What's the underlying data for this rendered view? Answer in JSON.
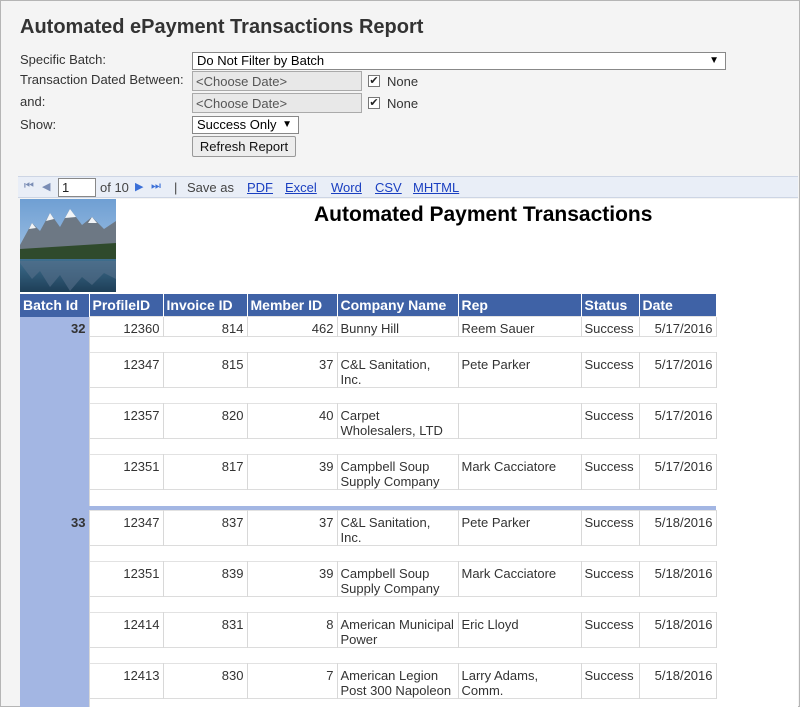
{
  "page": {
    "title": "Automated ePayment Transactions Report"
  },
  "filters": {
    "batch_label": "Specific Batch:",
    "batch_value": "Do Not Filter by Batch",
    "date_between_label": "Transaction Dated Between:",
    "date_from_placeholder": "<Choose Date>",
    "and_label": "and:",
    "date_to_placeholder": "<Choose Date>",
    "none_label_1": "None",
    "none_label_2": "None",
    "none_checked_1": true,
    "none_checked_2": true,
    "show_label": "Show:",
    "show_value": "Success Only",
    "refresh_label": "Refresh Report"
  },
  "toolbar": {
    "page_value": "1",
    "of_text": "of 10",
    "separator": "|",
    "save_as_label": "Save as",
    "formats": [
      "PDF",
      "Excel",
      "Word",
      "CSV",
      "MHTML"
    ]
  },
  "report": {
    "title": "Automated Payment Transactions",
    "columns": [
      "Batch Id",
      "ProfileID",
      "Invoice ID",
      "Member ID",
      "Company Name",
      "Rep",
      "Status",
      "Date"
    ],
    "batches": [
      {
        "batch_id": "32",
        "rows": [
          {
            "profile": "12360",
            "invoice": "814",
            "member": "462",
            "company": "Bunny Hill",
            "rep": "Reem Sauer",
            "status": "Success",
            "date": "5/17/2016"
          },
          {
            "profile": "12347",
            "invoice": "815",
            "member": "37",
            "company": "C&L Sanitation, Inc.",
            "rep": "Pete Parker",
            "status": "Success",
            "date": "5/17/2016"
          },
          {
            "profile": "12357",
            "invoice": "820",
            "member": "40",
            "company": "Carpet Wholesalers, LTD",
            "rep": "",
            "status": "Success",
            "date": "5/17/2016"
          },
          {
            "profile": "12351",
            "invoice": "817",
            "member": "39",
            "company": "Campbell Soup Supply Company",
            "rep": "Mark Cacciatore",
            "status": "Success",
            "date": "5/17/2016"
          }
        ]
      },
      {
        "batch_id": "33",
        "rows": [
          {
            "profile": "12347",
            "invoice": "837",
            "member": "37",
            "company": "C&L Sanitation, Inc.",
            "rep": "Pete Parker",
            "status": "Success",
            "date": "5/18/2016"
          },
          {
            "profile": "12351",
            "invoice": "839",
            "member": "39",
            "company": "Campbell Soup Supply Company",
            "rep": "Mark Cacciatore",
            "status": "Success",
            "date": "5/18/2016"
          },
          {
            "profile": "12414",
            "invoice": "831",
            "member": "8",
            "company": "American Municipal Power",
            "rep": "Eric Lloyd",
            "status": "Success",
            "date": "5/18/2016"
          },
          {
            "profile": "12413",
            "invoice": "830",
            "member": "7",
            "company": "American Legion Post 300 Napoleon",
            "rep": "Larry Adams, Comm.",
            "status": "Success",
            "date": "5/18/2016"
          }
        ]
      }
    ]
  },
  "colors": {
    "header_bg": "#3f62a6",
    "batch_bg": "#a3b6e3",
    "link": "#1a3fc0"
  },
  "icons": {
    "first": "first-page-icon",
    "prev": "previous-page-icon",
    "next": "next-page-icon",
    "last": "last-page-icon",
    "dropdown": "chevron-down-icon",
    "photo": "mountain-lake-image"
  }
}
